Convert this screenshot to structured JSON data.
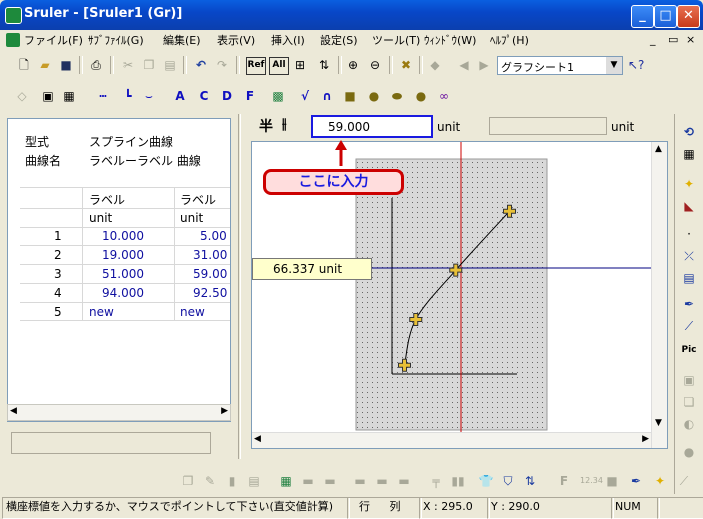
{
  "window": {
    "title": "Sruler - [Sruler1 (Gr)]",
    "buttons": {
      "min": "_",
      "max": "□",
      "close": "✕"
    }
  },
  "menu": {
    "items": [
      "ファイル(F)",
      "ｻﾌﾞﾌｧｲﾙ(G)",
      "編集(E)",
      "表示(V)",
      "挿入(I)",
      "設定(S)",
      "ツール(T)",
      "ｳｨﾝﾄﾞｳ(W)",
      "ﾍﾙﾌﾟ(H)"
    ]
  },
  "toolbar": {
    "sheet_select": "グラフシート1",
    "ref_label": "Ref",
    "all_label": "All"
  },
  "toolbar2": {
    "letters": [
      "A",
      "C",
      "D",
      "F"
    ]
  },
  "left": {
    "type_label": "型式",
    "type_value": "スプライン曲線",
    "name_label": "曲線名",
    "name_value": "ラベルーラベル 曲線",
    "col_headers": [
      "ラベル",
      "ラベル"
    ],
    "units": [
      "unit",
      "unit"
    ],
    "rows": [
      {
        "idx": "1",
        "x": "10.000",
        "y": "5.00"
      },
      {
        "idx": "2",
        "x": "19.000",
        "y": "31.00"
      },
      {
        "idx": "3",
        "x": "51.000",
        "y": "59.00"
      },
      {
        "idx": "4",
        "x": "94.000",
        "y": "92.50"
      },
      {
        "idx": "5",
        "x": "new",
        "y": "new"
      }
    ]
  },
  "input": {
    "value": "59.000",
    "unit1": "unit",
    "unit2": "unit",
    "annotation": "ここに入力"
  },
  "graph": {
    "readout": "66.337  unit",
    "points": [
      {
        "x": 10,
        "y": 5
      },
      {
        "x": 19,
        "y": 31
      },
      {
        "x": 51,
        "y": 59
      },
      {
        "x": 94,
        "y": 92.5
      }
    ],
    "axis_max": 100,
    "colors": {
      "curve": "#000000",
      "crosshair_v": "#cc0000",
      "crosshair_h": "#000080",
      "marker": "#e8c038",
      "annotation": "#cc0000"
    }
  },
  "status": {
    "message": "横座標値を入力するか、マウスでポイントして下さい(直交値計算)",
    "row_label": "行",
    "col_label": "列",
    "x": "X : 295.0",
    "y": "Y : 290.0",
    "num": "NUM"
  }
}
